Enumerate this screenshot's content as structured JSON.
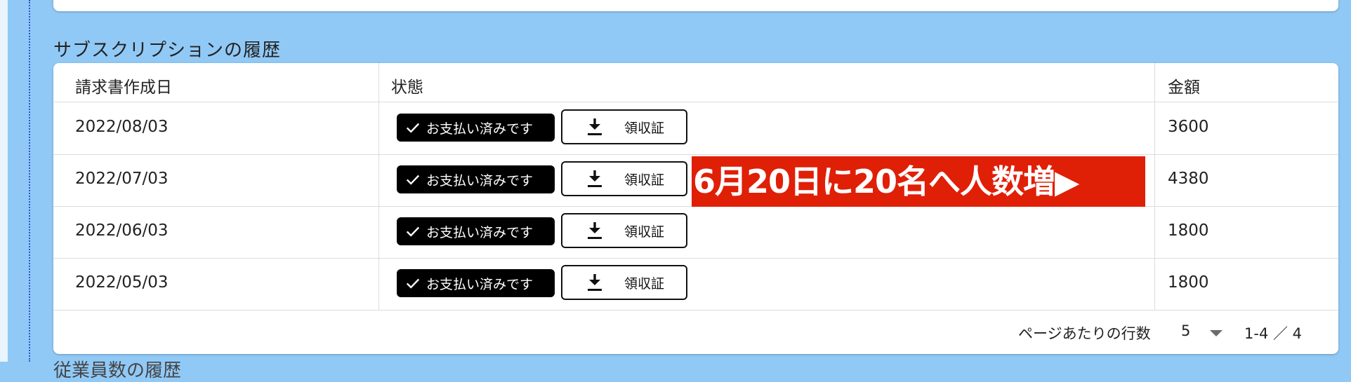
{
  "section": {
    "title": "サブスクリプションの履歴",
    "next_title_fragment": "従業員数の履歴"
  },
  "table": {
    "headers": {
      "date": "請求書作成日",
      "status": "状態",
      "amount": "金額"
    },
    "rows": [
      {
        "date": "2022/08/03",
        "status": "お支払い済みです",
        "receipt": "領収証",
        "amount": "3600"
      },
      {
        "date": "2022/07/03",
        "status": "お支払い済みです",
        "receipt": "領収証",
        "amount": "4380"
      },
      {
        "date": "2022/06/03",
        "status": "お支払い済みです",
        "receipt": "領収証",
        "amount": "1800"
      },
      {
        "date": "2022/05/03",
        "status": "お支払い済みです",
        "receipt": "領収証",
        "amount": "1800"
      }
    ]
  },
  "annotation": {
    "text": "6月20日に20名へ人数増▶",
    "color": "#e01f07"
  },
  "pagination": {
    "rows_per_page_label": "ページあたりの行数",
    "rows_per_page_value": "5",
    "range": "1-4 ／ 4"
  },
  "icons": {
    "status": "check-icon",
    "receipt": "download-icon",
    "dropdown": "caret-down-icon"
  }
}
